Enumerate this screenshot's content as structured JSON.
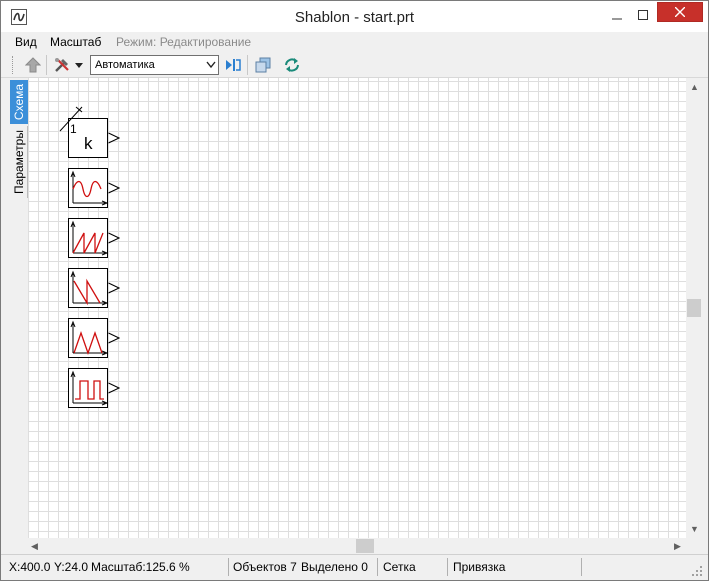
{
  "window": {
    "title": "Shablon - start.prt",
    "app_icon": "shablon-app-icon"
  },
  "menu": {
    "items": [
      "Вид",
      "Масштаб"
    ],
    "mode_label": "Режим:",
    "mode_value": "Редактирование"
  },
  "toolbar": {
    "combo_value": "Автоматика",
    "icons": [
      "up-arrow-icon",
      "tools-icon",
      "dropdown-arrow-icon",
      "step-icon",
      "copy-windows-icon",
      "refresh-icon"
    ]
  },
  "side_tabs": [
    "Схема",
    "Параметры"
  ],
  "blocks": [
    {
      "name": "gain-block",
      "label": "k",
      "index_label": "1"
    },
    {
      "name": "sine-generator-block"
    },
    {
      "name": "sawtooth-rising-block"
    },
    {
      "name": "sawtooth-falling-block"
    },
    {
      "name": "triangle-generator-block"
    },
    {
      "name": "square-pulse-block"
    }
  ],
  "status": {
    "x": "X:400.0",
    "y": "Y:24.0",
    "scale": "Масштаб:125.6 %",
    "objects": "Объектов 7",
    "selected": "Выделено 0",
    "grid": "Сетка",
    "snap": "Привязка"
  },
  "colors": {
    "accent_tab": "#3c8fd9",
    "close_button": "#c7302a",
    "signal": "#d01010",
    "grid_line": "#dedede"
  }
}
